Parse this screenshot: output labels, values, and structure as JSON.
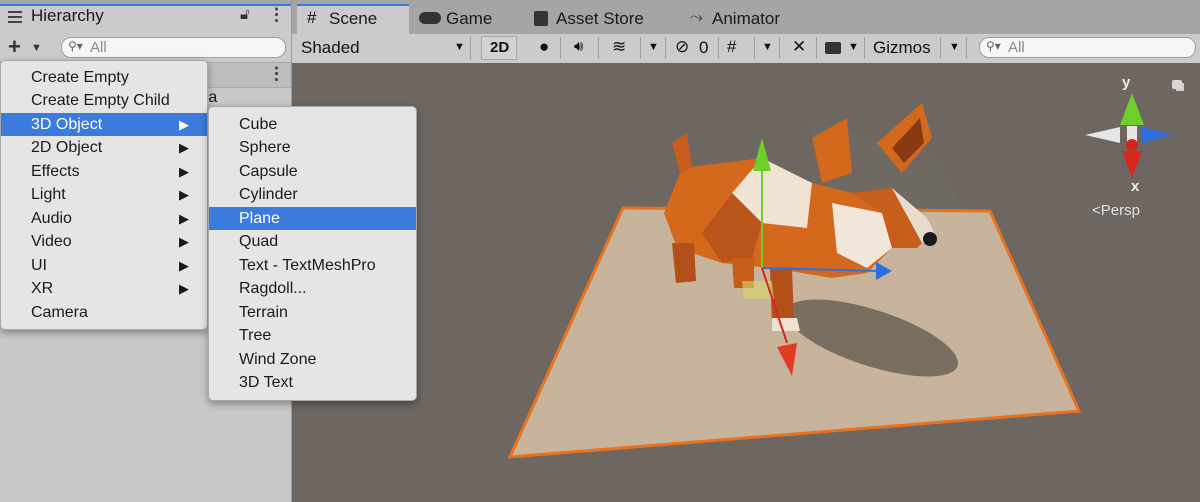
{
  "hierarchy": {
    "tab_title": "Hierarchy",
    "search_placeholder": "All",
    "scene_item_partial": "ra"
  },
  "scene_tabs": [
    {
      "label": "Scene",
      "icon": "grid-icon"
    },
    {
      "label": "Game",
      "icon": "gamepad-icon"
    },
    {
      "label": "Asset Store",
      "icon": "shopping-bag-icon"
    },
    {
      "label": "Animator",
      "icon": "animator-icon"
    }
  ],
  "scene_toolbar": {
    "shading_mode": "Shaded",
    "mode_2d": "2D",
    "hidden_count": "0",
    "gizmos_label": "Gizmos",
    "search_placeholder": "All"
  },
  "create_menu": {
    "items": [
      {
        "label": "Create Empty",
        "submenu": false
      },
      {
        "label": "Create Empty Child",
        "submenu": false
      },
      {
        "label": "3D Object",
        "submenu": true,
        "selected": true
      },
      {
        "label": "2D Object",
        "submenu": true
      },
      {
        "label": "Effects",
        "submenu": true
      },
      {
        "label": "Light",
        "submenu": true
      },
      {
        "label": "Audio",
        "submenu": true
      },
      {
        "label": "Video",
        "submenu": true
      },
      {
        "label": "UI",
        "submenu": true
      },
      {
        "label": "XR",
        "submenu": true
      },
      {
        "label": "Camera",
        "submenu": false
      }
    ]
  },
  "object_submenu": {
    "items": [
      {
        "label": "Cube"
      },
      {
        "label": "Sphere"
      },
      {
        "label": "Capsule"
      },
      {
        "label": "Cylinder"
      },
      {
        "label": "Plane",
        "selected": true
      },
      {
        "label": "Quad"
      },
      {
        "label": "Text - TextMeshPro"
      },
      {
        "label": "Ragdoll..."
      },
      {
        "label": "Terrain"
      },
      {
        "label": "Tree"
      },
      {
        "label": "Wind Zone"
      },
      {
        "label": "3D Text"
      }
    ]
  },
  "orientation_gizmo": {
    "y_label": "y",
    "x_label": "x",
    "projection_label": "Persp"
  },
  "colors": {
    "selection_blue": "#3b7bdc",
    "plane_outline": "#e8731f",
    "axis_x": "#d9261c",
    "axis_y": "#6fcf2a",
    "axis_z": "#2d6fe3"
  }
}
